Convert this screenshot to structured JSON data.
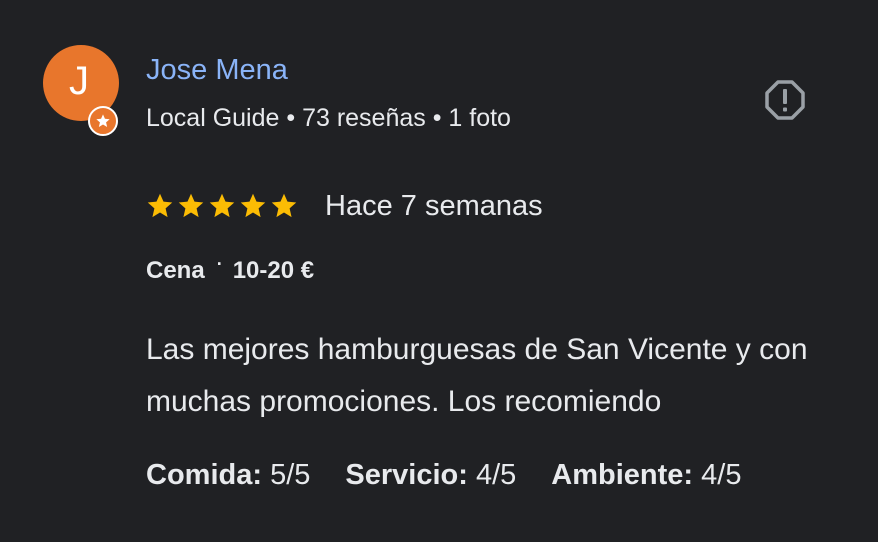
{
  "reviewer": {
    "initial": "J",
    "name": "Jose Mena",
    "meta": "Local Guide • 73 reseñas • 1 foto",
    "avatar_color": "#e8762c",
    "badge_icon": "star-icon"
  },
  "report": {
    "icon": "flag-alert-icon"
  },
  "rating": {
    "stars": 5,
    "max_stars": 5,
    "star_color": "#fbbc04",
    "date": "Hace 7 semanas"
  },
  "meal": {
    "type": "Cena",
    "separator": "·",
    "price": "10-20 €"
  },
  "review": {
    "text": "Las mejores hamburguesas de San Vicente y con muchas promociones. Los recomiendo"
  },
  "sub_ratings": [
    {
      "label": "Comida:",
      "value": "5/5"
    },
    {
      "label": "Servicio:",
      "value": "4/5"
    },
    {
      "label": "Ambiente:",
      "value": "4/5"
    }
  ]
}
